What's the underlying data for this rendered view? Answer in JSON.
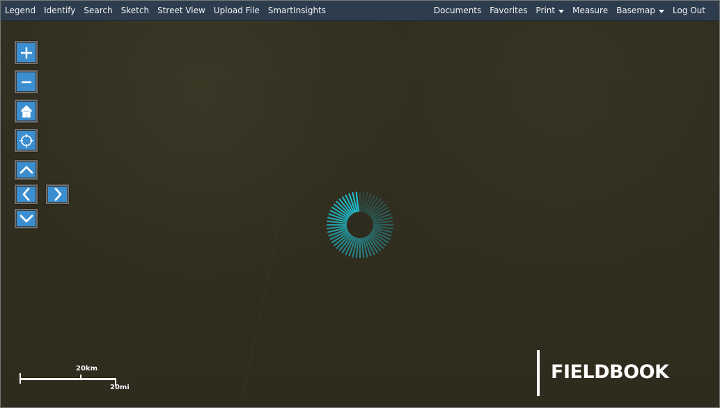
{
  "navbar": {
    "left_items": [
      "Legend",
      "Identify",
      "Search",
      "Sketch",
      "Street View",
      "Upload File",
      "SmartInsights"
    ],
    "right_items": [
      "Documents",
      "Favorites",
      "Print",
      "Measure",
      "Basemap",
      "Log Out"
    ]
  },
  "map_controls": {
    "icons": [
      "plus-icon",
      "minus-icon",
      "home-icon",
      "locate-icon",
      "chevron-up-icon",
      "chevron-left-icon",
      "chevron-right-icon",
      "chevron-down-icon"
    ]
  },
  "scale_bar": {
    "km_label": "20km",
    "mi_label": "20mi"
  },
  "brand": {
    "name": "FIELDBOOK"
  },
  "colors": {
    "navbar_bg": "#2e3d4e",
    "control_blue": "#3b8fd0",
    "map_bg": "#2f2c1f",
    "spinner": "#1ec5d8"
  }
}
